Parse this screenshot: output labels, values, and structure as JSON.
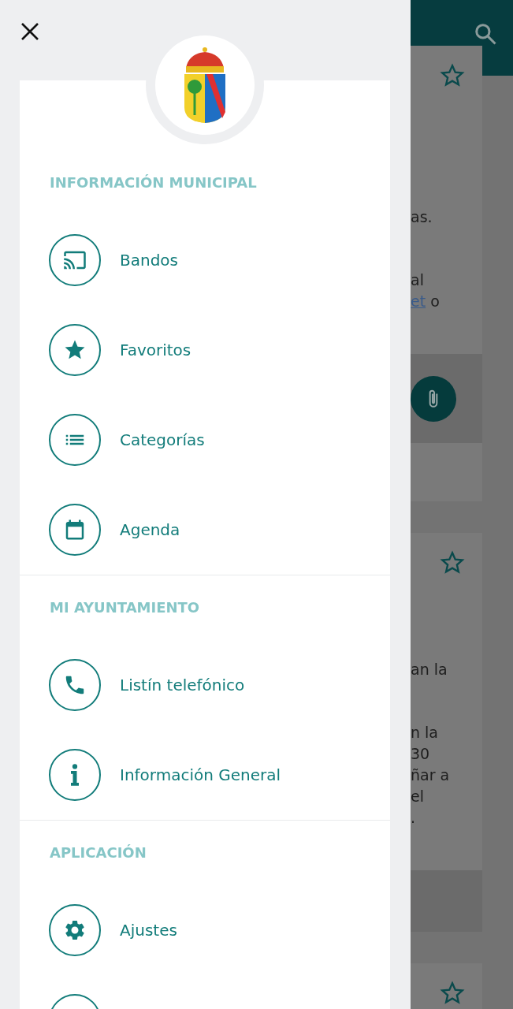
{
  "drawer": {
    "sections": [
      {
        "heading": "INFORMACIÓN MUNICIPAL",
        "items": [
          {
            "kind": "entry",
            "label": "Bandos"
          },
          {
            "kind": "entry",
            "label": "Favoritos"
          },
          {
            "kind": "entry",
            "label": "Categorías"
          },
          {
            "kind": "entry",
            "label": "Agenda"
          }
        ]
      },
      {
        "heading": "MI AYUNTAMIENTO",
        "items": [
          {
            "kind": "entry",
            "label": "Listín telefónico"
          },
          {
            "kind": "entry",
            "label": "Información General"
          }
        ]
      },
      {
        "heading": "APLICACIÓN",
        "items": [
          {
            "kind": "entry",
            "label": "Ajustes"
          },
          {
            "kind": "cut"
          }
        ]
      }
    ]
  },
  "background_cards": [
    {
      "kind": "attachment",
      "paragraphs": [
        [
          [
            {
              "kind": "text",
              "text": "as."
            }
          ]
        ],
        [
          [
            {
              "kind": "text",
              "text": "al"
            }
          ],
          [
            {
              "kind": "link",
              "text": "et"
            },
            {
              "kind": "text",
              "text": " o"
            }
          ]
        ]
      ]
    },
    {
      "kind": "attachment_hidden",
      "paragraphs": [
        [
          [
            {
              "kind": "text",
              "text": "an la"
            }
          ]
        ],
        [
          [
            {
              "kind": "text",
              "text": "n la"
            }
          ],
          [
            {
              "kind": "text",
              "text": "30"
            }
          ],
          [
            {
              "kind": "text",
              "text": "ñar a"
            }
          ],
          [
            {
              "kind": "text",
              "text": "el"
            }
          ],
          [
            {
              "kind": "text",
              "text": "."
            }
          ]
        ]
      ]
    },
    {
      "kind": "plain"
    }
  ]
}
